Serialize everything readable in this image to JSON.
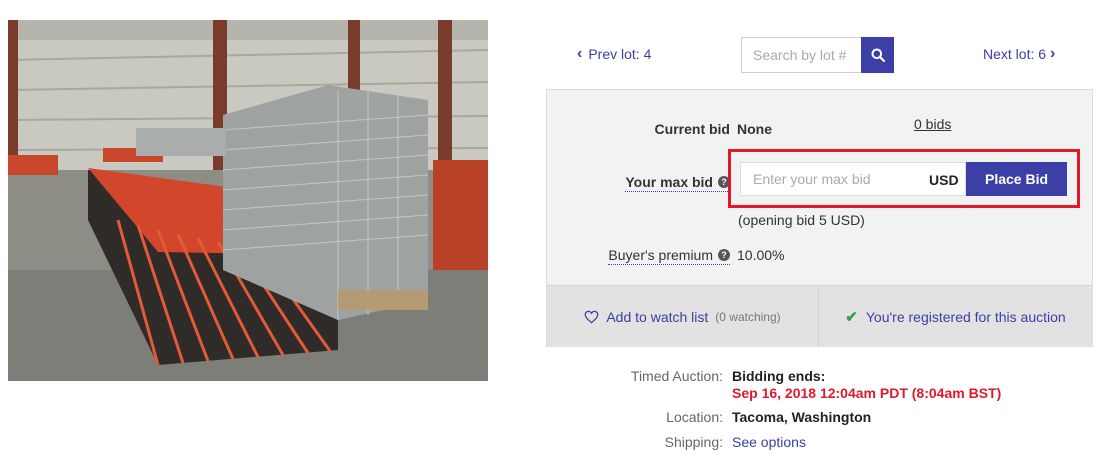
{
  "nav": {
    "prev_label": "Prev lot: 4",
    "next_label": "Next lot: 6",
    "search_placeholder": "Search by lot #"
  },
  "bid": {
    "current_bid_label": "Current bid",
    "current_bid_value": "None",
    "bids_count_link": "0 bids",
    "max_bid_label": "Your max bid",
    "max_bid_placeholder": "Enter your max bid",
    "currency": "USD",
    "place_bid_label": "Place Bid",
    "opening_bid_text": "(opening bid 5 USD)",
    "buyers_premium_label": "Buyer's premium",
    "buyers_premium_value": "10.00%"
  },
  "actions": {
    "watch_label": "Add to watch list",
    "watch_count": "(0 watching)",
    "registered_label": "You're registered for this auction"
  },
  "info": {
    "timed_auction_label": "Timed Auction:",
    "bidding_ends_label": "Bidding ends:",
    "end_datetime": "Sep 16, 2018 12:04am PDT (8:04am BST)",
    "location_label": "Location:",
    "location_value": "Tacoma, Washington",
    "shipping_label": "Shipping:",
    "shipping_link": "See options"
  },
  "colors": {
    "accent": "#3b3fa6",
    "highlight_red": "#e0192a",
    "check_green": "#2aa54a"
  },
  "icons": [
    "chevron-left-icon",
    "chevron-right-icon",
    "search-icon",
    "question-icon",
    "heart-icon",
    "check-icon"
  ]
}
